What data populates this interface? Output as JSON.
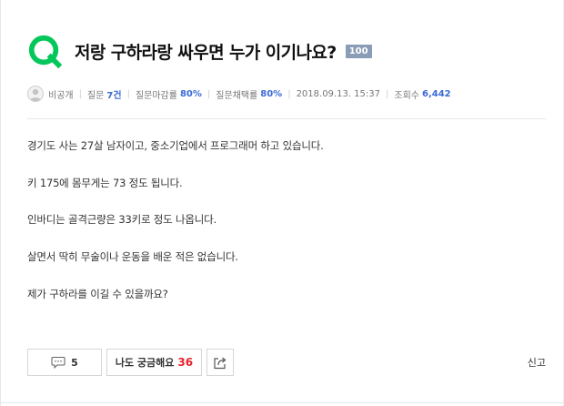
{
  "question": {
    "title": "저랑 구하라랑 싸우면 누가 이기나요?",
    "badge": "100"
  },
  "meta": {
    "author": "비공개",
    "question_label": "질문",
    "question_count": "7건",
    "close_rate_label": "질문마감률",
    "close_rate": "80%",
    "adopt_rate_label": "질문채택률",
    "adopt_rate": "80%",
    "datetime": "2018.09.13. 15:37",
    "views_label": "조회수",
    "views": "6,442"
  },
  "body": {
    "paragraphs": [
      "경기도 사는 27살 남자이고, 중소기업에서 프로그래머 하고 있습니다.",
      "키 175에 몸무게는 73 정도 됩니다.",
      "인바디는 골격근량은 33키로 정도 나옵니다.",
      "살면서 딱히 무술이나 운동을 배운 적은 없습니다.",
      "제가 구하라를 이길 수 있을까요?"
    ]
  },
  "actions": {
    "comment_count": "5",
    "curious_label": "나도 궁금해요",
    "curious_count": "36",
    "report_label": "신고"
  },
  "icons": {
    "question_mark": "q-circle-icon",
    "avatar": "user-avatar-icon",
    "comment": "speech-bubble-icon",
    "share": "share-icon"
  },
  "colors": {
    "accent_green": "#03c75a",
    "badge_bg": "#8a9cb6",
    "stat_blue": "#3a6ad6",
    "curious_red": "#e4232e"
  }
}
